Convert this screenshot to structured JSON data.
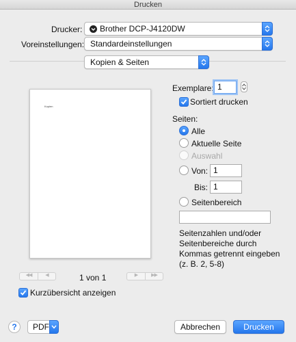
{
  "window": {
    "title": "Drucken"
  },
  "printer": {
    "label": "Drucker:",
    "value": "Brother DCP-J4120DW"
  },
  "presets": {
    "label": "Voreinstellungen:",
    "value": "Standardeinstellungen"
  },
  "section_popup": {
    "value": "Kopien & Seiten"
  },
  "preview": {
    "page_text": "Kopien"
  },
  "page_nav": {
    "first": "◀◀",
    "prev": "◀",
    "counter": "1 von 1",
    "next": "▶",
    "last": "▶▶"
  },
  "thumbnail_toggle": {
    "label": "Kurzübersicht anzeigen",
    "checked": true
  },
  "copies": {
    "label": "Exemplare:",
    "value": "1"
  },
  "collate": {
    "label": "Sortiert drucken",
    "checked": true
  },
  "pages": {
    "label": "Seiten:",
    "selected": "Alle",
    "options": {
      "all": "Alle",
      "current": "Aktuelle Seite",
      "selection": "Auswahl",
      "from": "Von:",
      "range": "Seitenbereich"
    },
    "to_label": "Bis:",
    "from_value": "1",
    "to_value": "1",
    "range_value": "",
    "hint": "Seitenzahlen und/oder Seitenbereiche durch Kommas getrennt eingeben (z. B. 2, 5-8)"
  },
  "footer": {
    "help": "?",
    "pdf": "PDF",
    "cancel": "Abbrechen",
    "print": "Drucken"
  },
  "colors": {
    "accent": "#2577ec",
    "window_bg": "#ececec"
  }
}
